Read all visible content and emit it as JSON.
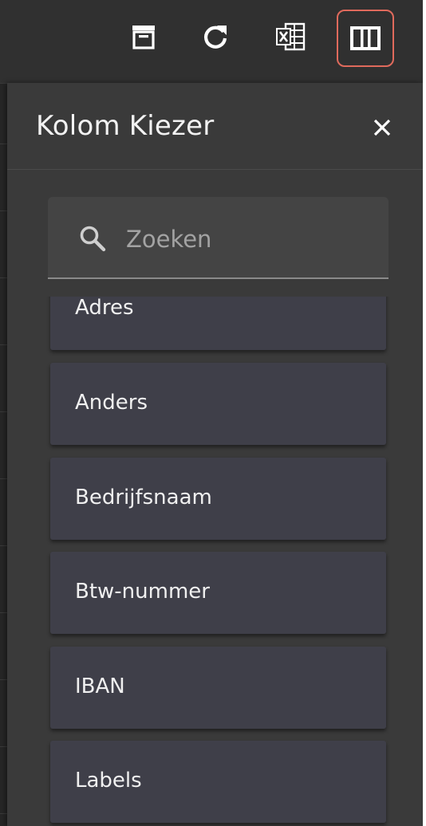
{
  "toolbar": {
    "buttons": [
      {
        "name": "archive",
        "icon": "archive-icon"
      },
      {
        "name": "refresh",
        "icon": "refresh-icon"
      },
      {
        "name": "export-excel",
        "icon": "excel-icon"
      },
      {
        "name": "column-picker",
        "icon": "columns-icon",
        "active": true
      }
    ]
  },
  "panel": {
    "title": "Kolom Kiezer",
    "close_icon": "close-icon"
  },
  "search": {
    "placeholder": "Zoeken",
    "value": "",
    "icon": "search-icon"
  },
  "columns": [
    {
      "label": "Adres"
    },
    {
      "label": "Anders"
    },
    {
      "label": "Bedrijfsnaam"
    },
    {
      "label": "Btw-nummer"
    },
    {
      "label": "IBAN"
    },
    {
      "label": "Labels"
    }
  ],
  "colors": {
    "accent_outline": "#e06a5c",
    "panel_bg": "#3a3a3a",
    "item_bg": "#3f3f49",
    "text": "#f0f0f0"
  }
}
